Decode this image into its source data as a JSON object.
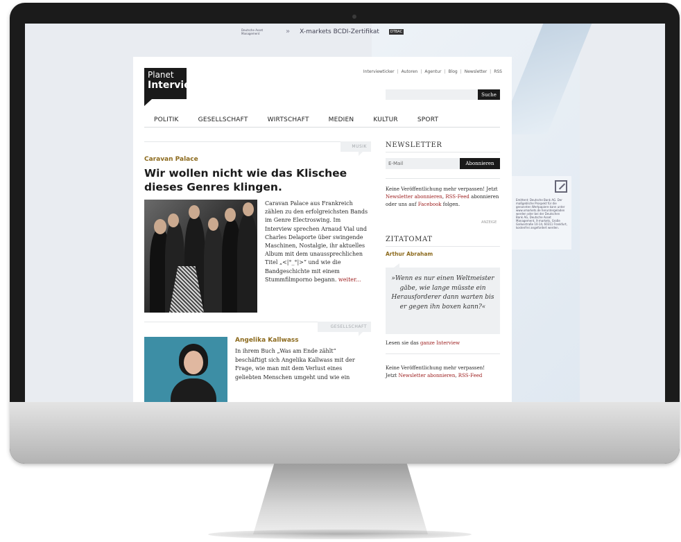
{
  "banner": {
    "dam_text": "Deutsche Asset Management",
    "product_text": "X-markets BCDI-Zertifikat",
    "tag": "DTBAC"
  },
  "side_ad": {
    "text": "Emittent: Deutsche Bank AG. Der maßgebliche Prospekt für die genannten Wertpapiere kann unter www.xmarkets.de heruntergeladen werden oder bei der Deutschen Bank AG, Deutsche Asset Management, X-markets, Große Gallusstraße 10-14, 60311 Frankfurt, kostenfrei angefordert werden."
  },
  "logo": {
    "line1": "Planet",
    "line2": "Interview"
  },
  "toplinks": [
    "Interviewticker",
    "Autoren",
    "Agentur",
    "Blog",
    "Newsletter",
    "RSS"
  ],
  "search": {
    "placeholder": "",
    "button": "Suche"
  },
  "nav": [
    "POLITIK",
    "GESELLSCHAFT",
    "WIRTSCHAFT",
    "MEDIEN",
    "KULTUR",
    "SPORT"
  ],
  "article1": {
    "category": "MUSIK",
    "kicker": "Caravan Palace",
    "headline": "Wir wollen nicht wie das Klischee dieses Genres klingen.",
    "teaser": "Caravan Palace aus Frankreich zählen zu den erfolgreichsten Bands im Genre Electroswing. Im Interview sprechen Arnaud Vial und Charles Delaporte über swingende Maschinen, Nostalgie, ihr aktuelles Album mit dem unaussprechlichen Titel „<|°_°|>“ und wie die Bandgeschichte mit einem Stummfilmporno begann.",
    "more": "weiter..."
  },
  "article2": {
    "category": "GESELLSCHAFT",
    "kicker": "Angelika Kallwass",
    "teaser": "In ihrem Buch „Was am Ende zählt“ beschäftigt sich Angelika Kallwass mit der Frage, wie man mit dem Verlust eines geliebten Menschen umgeht und wie ein"
  },
  "newsletter": {
    "title": "NEWSLETTER",
    "email_placeholder": "E-Mail",
    "button": "Abonnieren",
    "promo_1": "Keine Veröffentlichung mehr verpassen! Jetzt",
    "promo_link1": "Newsletter abonnieren",
    "promo_sep": ",",
    "promo_link2": "RSS-Feed",
    "promo_2": "abonnieren oder uns auf",
    "promo_link3": "Facebook",
    "promo_3": "folgen.",
    "anzeige": "ANZEIGE"
  },
  "zitatomat": {
    "title": "ZITATOMAT",
    "author": "Arthur Abraham",
    "quote": "»Wenn es nur einen Weltmeister gäbe, wie lange müsste ein Herausforderer dann warten bis er gegen ihn boxen kann?«",
    "link_prefix": "Lesen sie das",
    "link": "ganze Interview"
  },
  "promo_bottom": {
    "line1": "Keine Veröffentlichung mehr verpassen!",
    "line2_prefix": "Jetzt",
    "link1": "Newsletter abonnieren",
    "link2": "RSS-Feed"
  }
}
